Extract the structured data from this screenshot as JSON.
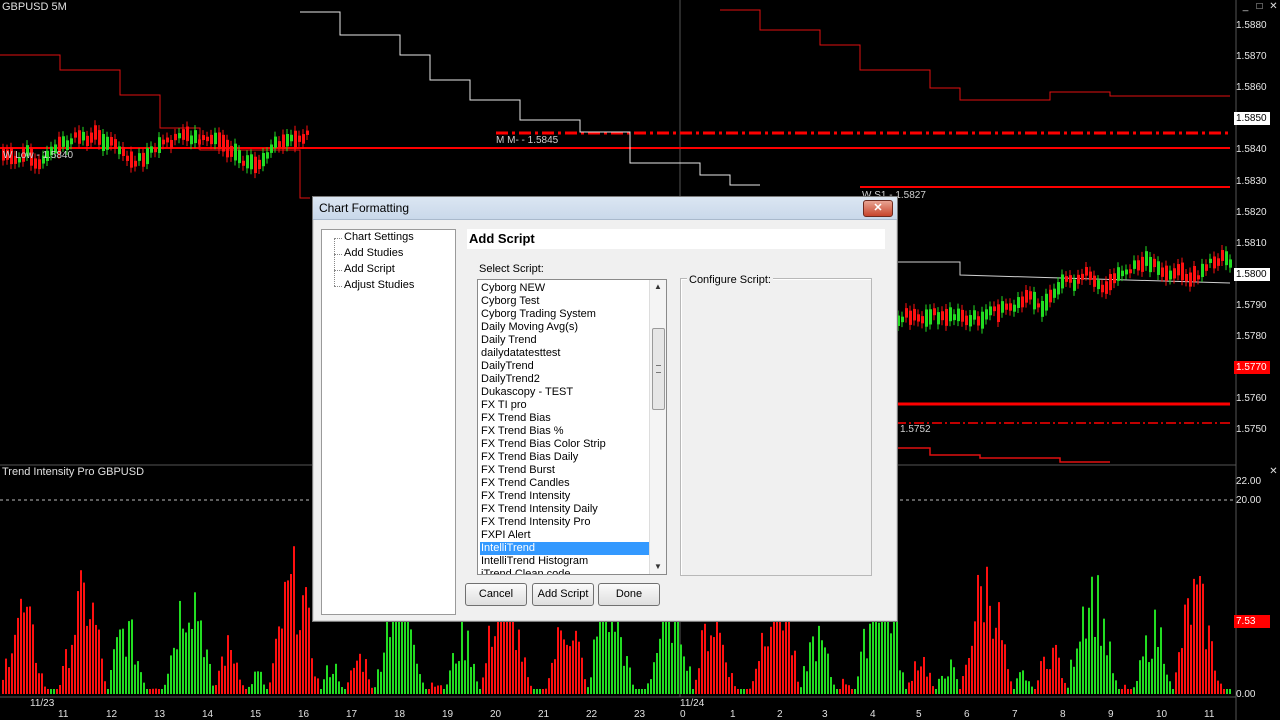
{
  "chart": {
    "symbol_title": "GBPUSD 5M",
    "indicator_title": "Trend Intensity Pro GBPUSD",
    "price_labels": [
      "1.5880",
      "1.5870",
      "1.5860",
      "1.5850",
      "1.5840",
      "1.5830",
      "1.5820",
      "1.5810",
      "1.5800",
      "1.5790",
      "1.5780",
      "1.5770",
      "1.5760",
      "1.5750"
    ],
    "current_price": "1.5770",
    "highlighted_prices": [
      "1.5850",
      "1.5800"
    ],
    "indicator_labels": [
      "22.00",
      "20.00",
      "7.53",
      "0.00"
    ],
    "time_labels": [
      "11/23",
      "11",
      "12",
      "13",
      "14",
      "15",
      "16",
      "17",
      "18",
      "19",
      "20",
      "21",
      "22",
      "23",
      "11/24",
      "0",
      "1",
      "2",
      "3",
      "4",
      "5",
      "6",
      "7",
      "8",
      "9",
      "10",
      "11"
    ],
    "annotations": {
      "w_low": "W Low - 1.5840",
      "m_m": "M M- - 1.5845",
      "w_s1": "W S1 - 1.5827",
      "level_5752": "1.5752"
    },
    "colors": {
      "up": "#22dd22",
      "down": "#ff1010",
      "level": "#ff0000",
      "background": "#000000"
    }
  },
  "dialog": {
    "title": "Chart Formatting",
    "close_label": "✕",
    "nav_items": [
      "Chart Settings",
      "Add Studies",
      "Add Script",
      "Adjust Studies"
    ],
    "panel_title": "Add Script",
    "select_label": "Select Script:",
    "configure_label": "Configure Script:",
    "scripts": [
      "Cyborg NEW",
      "Cyborg Test",
      "Cyborg Trading System",
      "Daily Moving Avg(s)",
      "Daily Trend",
      "dailydatatesttest",
      "DailyTrend",
      "DailyTrend2",
      "Dukascopy - TEST",
      "FX TI pro",
      "FX Trend Bias",
      "FX Trend Bias %",
      "FX Trend Bias Color Strip",
      "FX Trend Bias Daily",
      "FX Trend Burst",
      "FX Trend Candles",
      "FX Trend Intensity",
      "FX Trend Intensity Daily",
      "FX Trend Intensity Pro",
      "FXPI Alert",
      "IntelliTrend",
      "IntelliTrend Histogram",
      "iTrend Clean code"
    ],
    "selected_script": "IntelliTrend",
    "buttons": {
      "cancel": "Cancel",
      "add_script": "Add Script",
      "done": "Done"
    }
  }
}
